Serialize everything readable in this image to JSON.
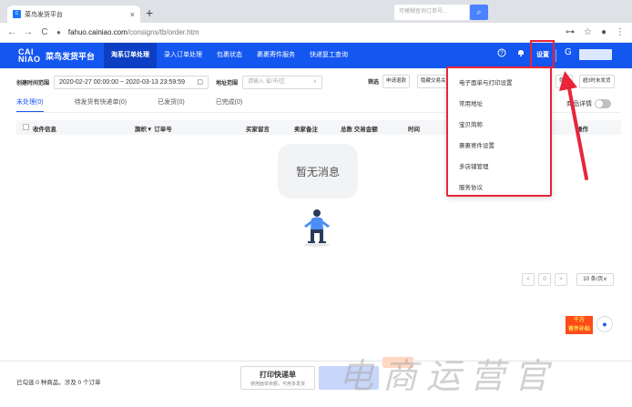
{
  "browser": {
    "tab_title": "菜鸟发货平台",
    "tab_close": "×",
    "new_tab": "+",
    "url_host": "fahuo.cainiao.com",
    "url_path": "/consigns/tb/order.htm",
    "back": "←",
    "forward": "→",
    "reload": "C",
    "lock": "🔒",
    "key": "⊶",
    "bookmark": "☆",
    "profile": "●",
    "menu": "⋮"
  },
  "app": {
    "logo_mark_top": "CAI",
    "logo_mark_bottom": "NIAO",
    "logo_text": "菜鸟发货平台",
    "nav": [
      "淘系订单处理",
      "录入订单处理",
      "包裹状态",
      "裹裹寄件服务",
      "快递复工查询"
    ],
    "search_placeholder": "可模糊查询订单号...",
    "search_icon": "⌕",
    "help_icon": "?",
    "notify_icon": "●",
    "settings_label": "设置",
    "user_icon": "G"
  },
  "filters": {
    "created_label": "创建时间范围",
    "date_range": "2020-02-27 00:00:00 ~ 2020-03-13 23:59:59",
    "calendar_icon": "▢",
    "address_label": "地址范围",
    "address_placeholder": "请输入 省/市/区",
    "chevron": "∨",
    "filter_label": "筛选",
    "chips": [
      "申请退款",
      "隐藏交易关",
      "筛选",
      "超3时未发货"
    ]
  },
  "order_tabs": [
    "未处理(0)",
    "待发货有快递单(0)",
    "已发货(0)",
    "已完成(0)"
  ],
  "toggle_label": "商品详情",
  "table_header": {
    "goods": "收件信息",
    "order": "旗帜▼ 订单号",
    "buyer_msg": "买家留言",
    "seller_note": "卖家备注",
    "total": "总数 交易金额",
    "time": "时间",
    "ops": "操作"
  },
  "empty_text": "暂无消息",
  "pagination": {
    "prev": "<",
    "page": "0",
    "next": ">",
    "size": "10 条/页∨"
  },
  "settings_menu": [
    "电子面单与打印设置",
    "常用地址",
    "宝贝简称",
    "裹裹寄件设置",
    "多店铺管理",
    "服务协议"
  ],
  "footer": {
    "selected": "已勾选 0 种商品，涉及 0 个订单",
    "print_main": "打印快递单",
    "print_sub": "使用面单余额，可用多发货"
  },
  "promo": "千万\n寄件补贴",
  "float_icon": "●",
  "watermark": "电商运营官",
  "colors": {
    "brand": "#1456f0",
    "highlight": "#e8253a"
  }
}
